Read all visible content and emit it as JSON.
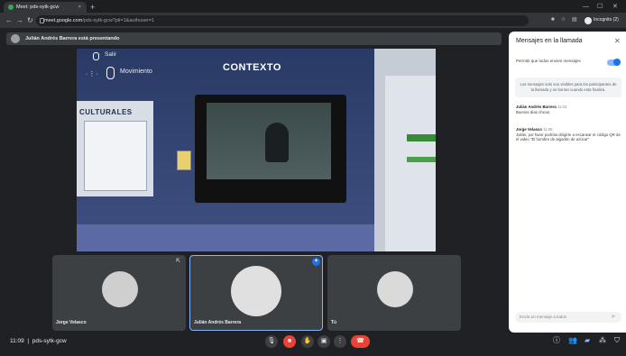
{
  "browser": {
    "tab_title": "Meet: pds-sytk-gcw",
    "tab_close": "×",
    "new_tab": "+",
    "url_host": "meet.google.com",
    "url_path": "/pds-sytk-gcw?pli=1&authuser=1",
    "incognito_label": "Incognito (2)"
  },
  "presenter_banner": "Julián Andrés Barrera está presentando",
  "shared_screen": {
    "title": "CONTEXTO",
    "exit_label": "Salir",
    "move_label": "Movimiento",
    "panel_heading": "CULTURALES"
  },
  "participants": [
    {
      "name": "Jorge Velasco"
    },
    {
      "name": "Julián Andrés Barrera"
    },
    {
      "name": "Tú"
    }
  ],
  "bottom_bar": {
    "time": "11:09",
    "meeting_code": "pds-sytk-gcw"
  },
  "chat": {
    "title": "Mensajes en la llamada",
    "toggle_label": "Permitir que todos envíen mensajes",
    "info": "Los mensajes solo son visibles para los participantes de la llamada y se borran cuando esta finaliza.",
    "messages": [
      {
        "sender": "Julián Andrés Barrera",
        "time": "11:04",
        "text": "Buenos días chicos"
      },
      {
        "sender": "Jorge Velasco",
        "time": "11:06",
        "text": "Julián, por favor podrías dirigirte a escanear el código QR de el video \"El hombre de algodón de azúcar\""
      }
    ],
    "input_placeholder": "Envía un mensaje a todos"
  }
}
